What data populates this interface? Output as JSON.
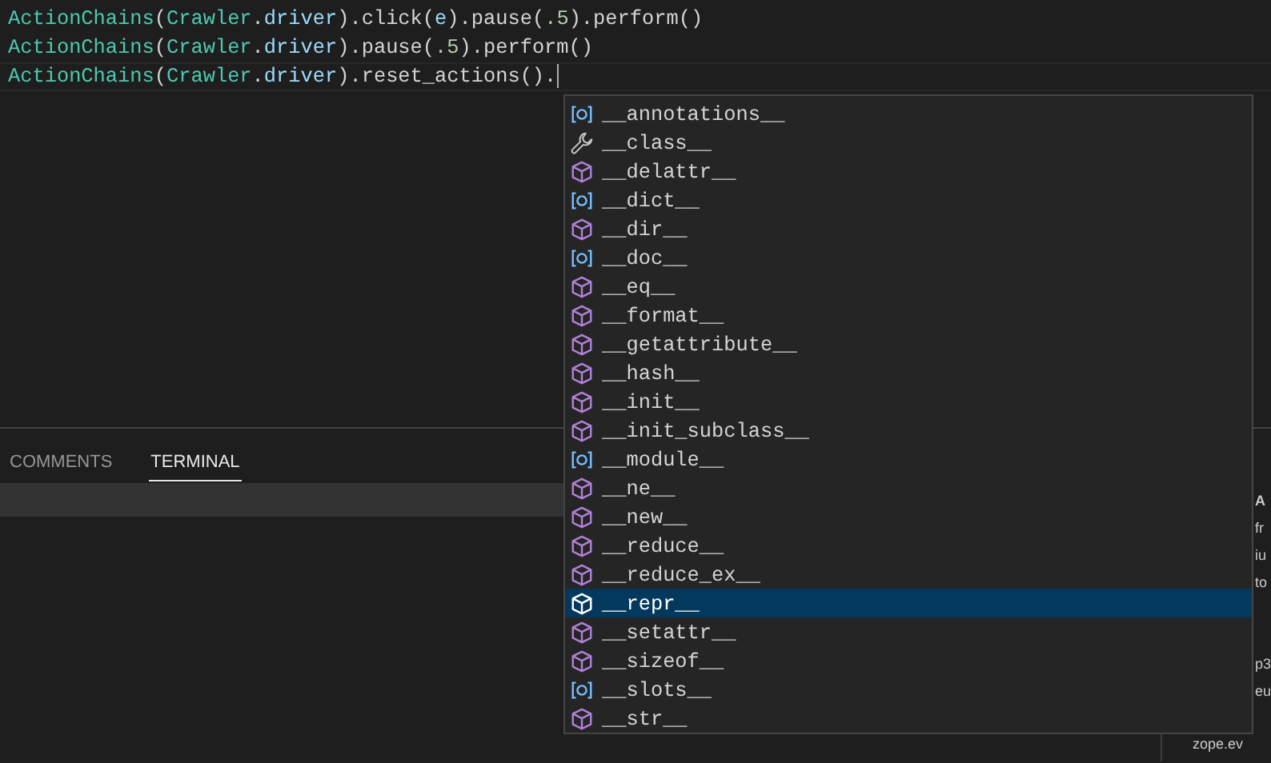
{
  "editor": {
    "lines": [
      {
        "current": false,
        "tokens": [
          {
            "kind": "class",
            "text": "ActionChains"
          },
          {
            "kind": "plain",
            "text": "("
          },
          {
            "kind": "class",
            "text": "Crawler"
          },
          {
            "kind": "plain",
            "text": "."
          },
          {
            "kind": "property",
            "text": "driver"
          },
          {
            "kind": "plain",
            "text": ").click("
          },
          {
            "kind": "variable",
            "text": "e"
          },
          {
            "kind": "plain",
            "text": ").pause("
          },
          {
            "kind": "number",
            "text": ".5"
          },
          {
            "kind": "plain",
            "text": ").perform()"
          }
        ]
      },
      {
        "current": false,
        "tokens": [
          {
            "kind": "class",
            "text": "ActionChains"
          },
          {
            "kind": "plain",
            "text": "("
          },
          {
            "kind": "class",
            "text": "Crawler"
          },
          {
            "kind": "plain",
            "text": "."
          },
          {
            "kind": "property",
            "text": "driver"
          },
          {
            "kind": "plain",
            "text": ").pause("
          },
          {
            "kind": "number",
            "text": ".5"
          },
          {
            "kind": "plain",
            "text": ").perform()"
          }
        ]
      },
      {
        "current": true,
        "tokens": [
          {
            "kind": "class",
            "text": "ActionChains"
          },
          {
            "kind": "plain",
            "text": "("
          },
          {
            "kind": "class",
            "text": "Crawler"
          },
          {
            "kind": "plain",
            "text": "."
          },
          {
            "kind": "property",
            "text": "driver"
          },
          {
            "kind": "plain",
            "text": ").reset_actions()."
          }
        ]
      }
    ]
  },
  "suggestions": [
    {
      "kind": "field",
      "label": "__annotations__",
      "selected": false
    },
    {
      "kind": "class",
      "label": "__class__",
      "selected": false
    },
    {
      "kind": "method",
      "label": "__delattr__",
      "selected": false
    },
    {
      "kind": "field",
      "label": "__dict__",
      "selected": false
    },
    {
      "kind": "method",
      "label": "__dir__",
      "selected": false
    },
    {
      "kind": "field",
      "label": "__doc__",
      "selected": false
    },
    {
      "kind": "method",
      "label": "__eq__",
      "selected": false
    },
    {
      "kind": "method",
      "label": "__format__",
      "selected": false
    },
    {
      "kind": "method",
      "label": "__getattribute__",
      "selected": false
    },
    {
      "kind": "method",
      "label": "__hash__",
      "selected": false
    },
    {
      "kind": "method",
      "label": "__init__",
      "selected": false
    },
    {
      "kind": "method",
      "label": "__init_subclass__",
      "selected": false
    },
    {
      "kind": "field",
      "label": "__module__",
      "selected": false
    },
    {
      "kind": "method",
      "label": "__ne__",
      "selected": false
    },
    {
      "kind": "method",
      "label": "__new__",
      "selected": false
    },
    {
      "kind": "method",
      "label": "__reduce__",
      "selected": false
    },
    {
      "kind": "method",
      "label": "__reduce_ex__",
      "selected": false
    },
    {
      "kind": "method",
      "label": "__repr__",
      "selected": true
    },
    {
      "kind": "method",
      "label": "__setattr__",
      "selected": false
    },
    {
      "kind": "method",
      "label": "__sizeof__",
      "selected": false
    },
    {
      "kind": "field",
      "label": "__slots__",
      "selected": false
    },
    {
      "kind": "method",
      "label": "__str__",
      "selected": false
    }
  ],
  "panel": {
    "tabs": [
      {
        "label": "COMMENTS",
        "selected": false
      },
      {
        "label": "TERMINAL",
        "selected": true
      }
    ]
  },
  "side_pane": {
    "lines": [
      {
        "kind": "header",
        "text": "A"
      },
      {
        "kind": "text",
        "text": "fr"
      },
      {
        "kind": "text",
        "text": "iu"
      },
      {
        "kind": "text",
        "text": "to"
      },
      {
        "kind": "blank"
      },
      {
        "kind": "blank"
      },
      {
        "kind": "text",
        "text": "p3"
      },
      {
        "kind": "text",
        "text": "eu"
      },
      {
        "kind": "blank"
      },
      {
        "kind": "wide",
        "text": "zope.ev"
      }
    ]
  }
}
